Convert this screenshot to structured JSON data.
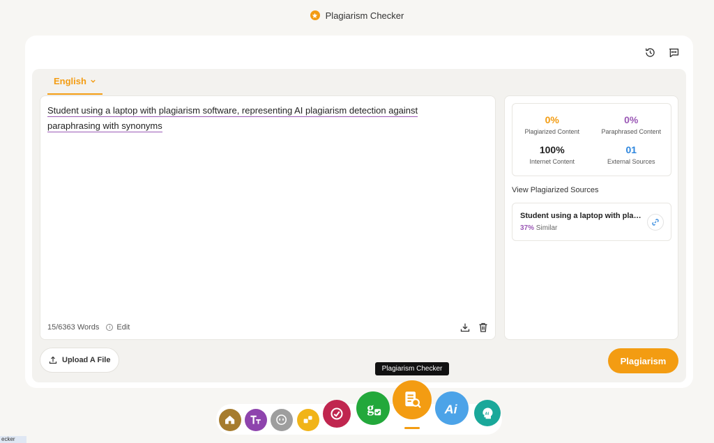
{
  "app": {
    "title": "Plagiarism Checker"
  },
  "language": {
    "selected": "English"
  },
  "editor": {
    "text": "Student using a laptop with plagiarism software, representing AI plagiarism detection against paraphrasing with synonyms",
    "word_count": "15/6363 Words",
    "edit_label": "Edit"
  },
  "results": {
    "stats": [
      {
        "value": "0%",
        "label": "Plagiarized Content",
        "color": "#f39c12"
      },
      {
        "value": "0%",
        "label": "Paraphrased Content",
        "color": "#9b59b6"
      },
      {
        "value": "100%",
        "label": "Internet Content",
        "color": "#222222"
      },
      {
        "value": "01",
        "label": "External Sources",
        "color": "#2e86de"
      }
    ],
    "sources_title": "View Plagiarized Sources",
    "source": {
      "name": "Student using a laptop with plagiarism software",
      "similarity": "37%",
      "similarity_label": "Similar"
    }
  },
  "actions": {
    "upload_label": "Upload A File",
    "primary_label": "Plagiarism"
  },
  "tooltip": "Plagiarism Checker",
  "dock": {
    "items": [
      {
        "icon": "home-icon",
        "color": "#a67c2e"
      },
      {
        "icon": "text-icon",
        "color": "#8e44ad"
      },
      {
        "icon": "quote-icon",
        "color": "#9e9e9e"
      },
      {
        "icon": "puzzle-icon",
        "color": "#f1b418"
      },
      {
        "icon": "grammar-hands-icon",
        "color": "#c0264f"
      },
      {
        "icon": "grammar-check-icon",
        "color": "#23a83b"
      },
      {
        "icon": "plagiarism-icon",
        "color": "#f39c12"
      },
      {
        "icon": "ai-icon",
        "color": "#4ca3e8"
      },
      {
        "icon": "ai-head-icon",
        "color": "#1aa89a"
      }
    ]
  },
  "corner_tab": "ecker"
}
